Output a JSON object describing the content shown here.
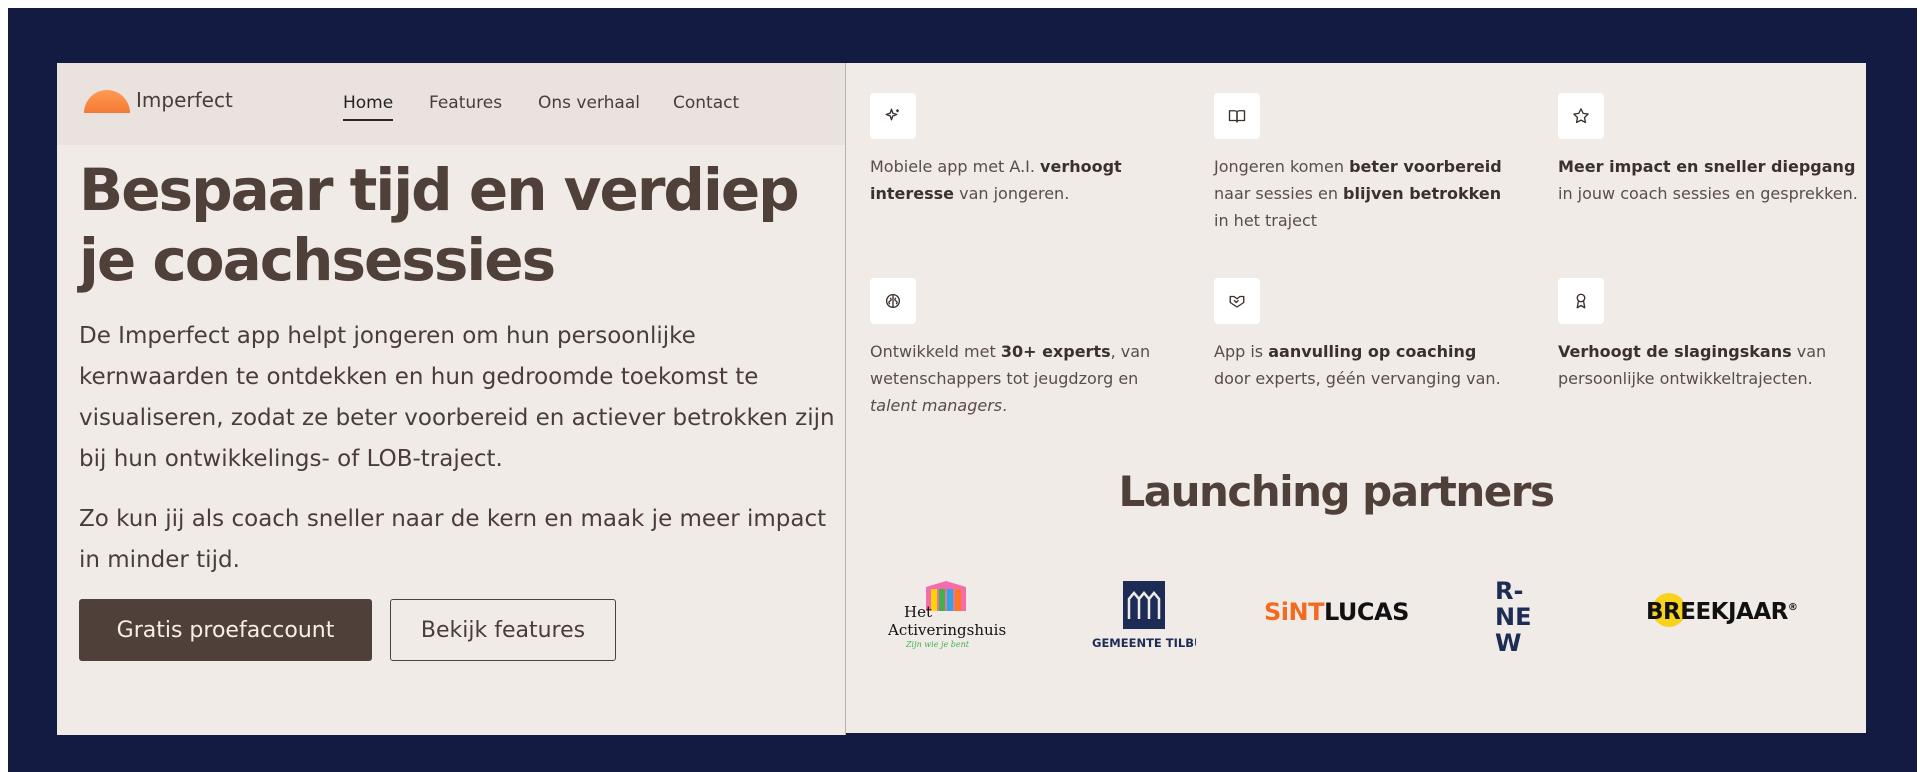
{
  "brand": {
    "name": "Imperfect"
  },
  "nav": {
    "items": [
      {
        "label": "Home",
        "active": true
      },
      {
        "label": "Features"
      },
      {
        "label": "Ons verhaal"
      },
      {
        "label": "Contact"
      }
    ]
  },
  "hero": {
    "title_line1": "Bespaar tijd en verdiep",
    "title_line2": "je coachsessies",
    "paragraph1": "De Imperfect app helpt jongeren om hun persoonlijke kernwaarden te ontdekken en hun gedroomde toekomst te visualiseren, zodat ze beter voorbereid en actiever betrokken zijn bij hun ontwikkelings- of LOB-traject.",
    "paragraph2": "Zo kun jij als coach sneller naar de kern en maak je meer impact in minder tijd.",
    "primary_cta": "Gratis proefaccount",
    "secondary_cta": "Bekijk features"
  },
  "features": [
    {
      "icon": "sparkles-icon",
      "t1": "Mobiele app met A.I. ",
      "b1": "verhoogt interesse",
      "t2": " van jongeren.",
      "b2": "",
      "t3": ""
    },
    {
      "icon": "book-open-icon",
      "t1": "Jongeren komen ",
      "b1": "beter voorbereid",
      "t2": " naar sessies en ",
      "b2": "blijven betrokken",
      "t3": " in het traject"
    },
    {
      "icon": "star-icon",
      "t1": "",
      "b1": "Meer impact en sneller diepgang",
      "t2": " in jouw coach sessies en gesprekken.",
      "b2": "",
      "t3": ""
    },
    {
      "icon": "brain-icon",
      "t1": "Ontwikkeld met ",
      "b1": "30+ experts",
      "t2": ", van wetenschappers tot jeugdzorg en ",
      "b2": "",
      "t3": "",
      "i1": "talent managers",
      "t4": "."
    },
    {
      "icon": "handshake-icon",
      "t1": "App is ",
      "b1": "aanvulling op coaching",
      "t2": " door experts, géén vervanging van.",
      "b2": "",
      "t3": ""
    },
    {
      "icon": "award-icon",
      "t1": "",
      "b1": "Verhoogt de slagingskans",
      "t2": " van persoonlijke ontwikkeltrajecten.",
      "b2": "",
      "t3": ""
    }
  ],
  "partners": {
    "title": "Launching partners",
    "logos": [
      {
        "name": "Het Activeringshuis",
        "line1": "Het",
        "line2": "Activeringshuis",
        "tagline": "Zijn wie je bent"
      },
      {
        "name": "Gemeente Tilburg",
        "label": "GEMEENTE TILBURG"
      },
      {
        "name": "Sint Lucas",
        "part1": "SiNT",
        "part2": "LUCAS"
      },
      {
        "name": "Renew",
        "l1": "R-",
        "l2": "NE",
        "l3": "W"
      },
      {
        "name": "Breekjaar",
        "text": "BREEKJAAR",
        "mark": "®"
      }
    ]
  },
  "colors": {
    "frame": "#141b43",
    "panel": "#f1ebe7",
    "text_dark": "#4f4039",
    "logo_orange": "#f47a36",
    "sintlucas_orange": "#f26b21",
    "tilburg_blue": "#1c2c55",
    "renew_blue": "#1c2c55",
    "breekjaar_yellow": "#f7d31e"
  }
}
